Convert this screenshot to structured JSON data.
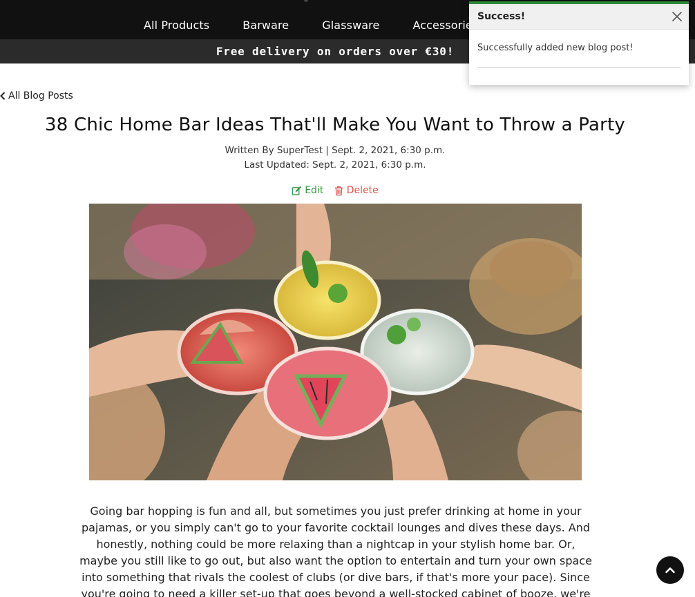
{
  "nav": {
    "items": [
      {
        "label": "All Products"
      },
      {
        "label": "Barware"
      },
      {
        "label": "Glassware"
      },
      {
        "label": "Accessorie"
      }
    ]
  },
  "promo": {
    "text": "Free delivery on orders over €30!"
  },
  "toast": {
    "title": "Success!",
    "message": "Successfully added new blog post!",
    "accent": "#2e8b3a"
  },
  "back_link": {
    "label": "All Blog Posts",
    "icon": "chevron-left-icon"
  },
  "post": {
    "title": "38 Chic Home Bar Ideas That'll Make You Want to Throw a Party",
    "written_by": "Written By SuperTest | Sept. 2, 2021, 6:30 p.m.",
    "last_updated": "Last Updated: Sept. 2, 2021, 6:30 p.m.",
    "edit_label": "Edit",
    "delete_label": "Delete",
    "body": "Going bar hopping is fun and all, but sometimes you just prefer drinking at home in your pajamas, or you simply can't go to your favorite cocktail lounges and dives these days. And honestly, nothing could be more relaxing than a nightcap in your stylish home bar. Or, maybe you still like to go out, but also want the option to entertain and turn your own space into something that rivals the coolest of clubs (or dive bars, if that's more your pace). Since you're going to need a killer set-up that goes beyond a well-stocked cabinet of booze, we're"
  },
  "colors": {
    "nav_bg": "#111111",
    "promo_bg": "#2b2b2b",
    "edit": "#3d9a4a",
    "delete": "#d9534f"
  }
}
